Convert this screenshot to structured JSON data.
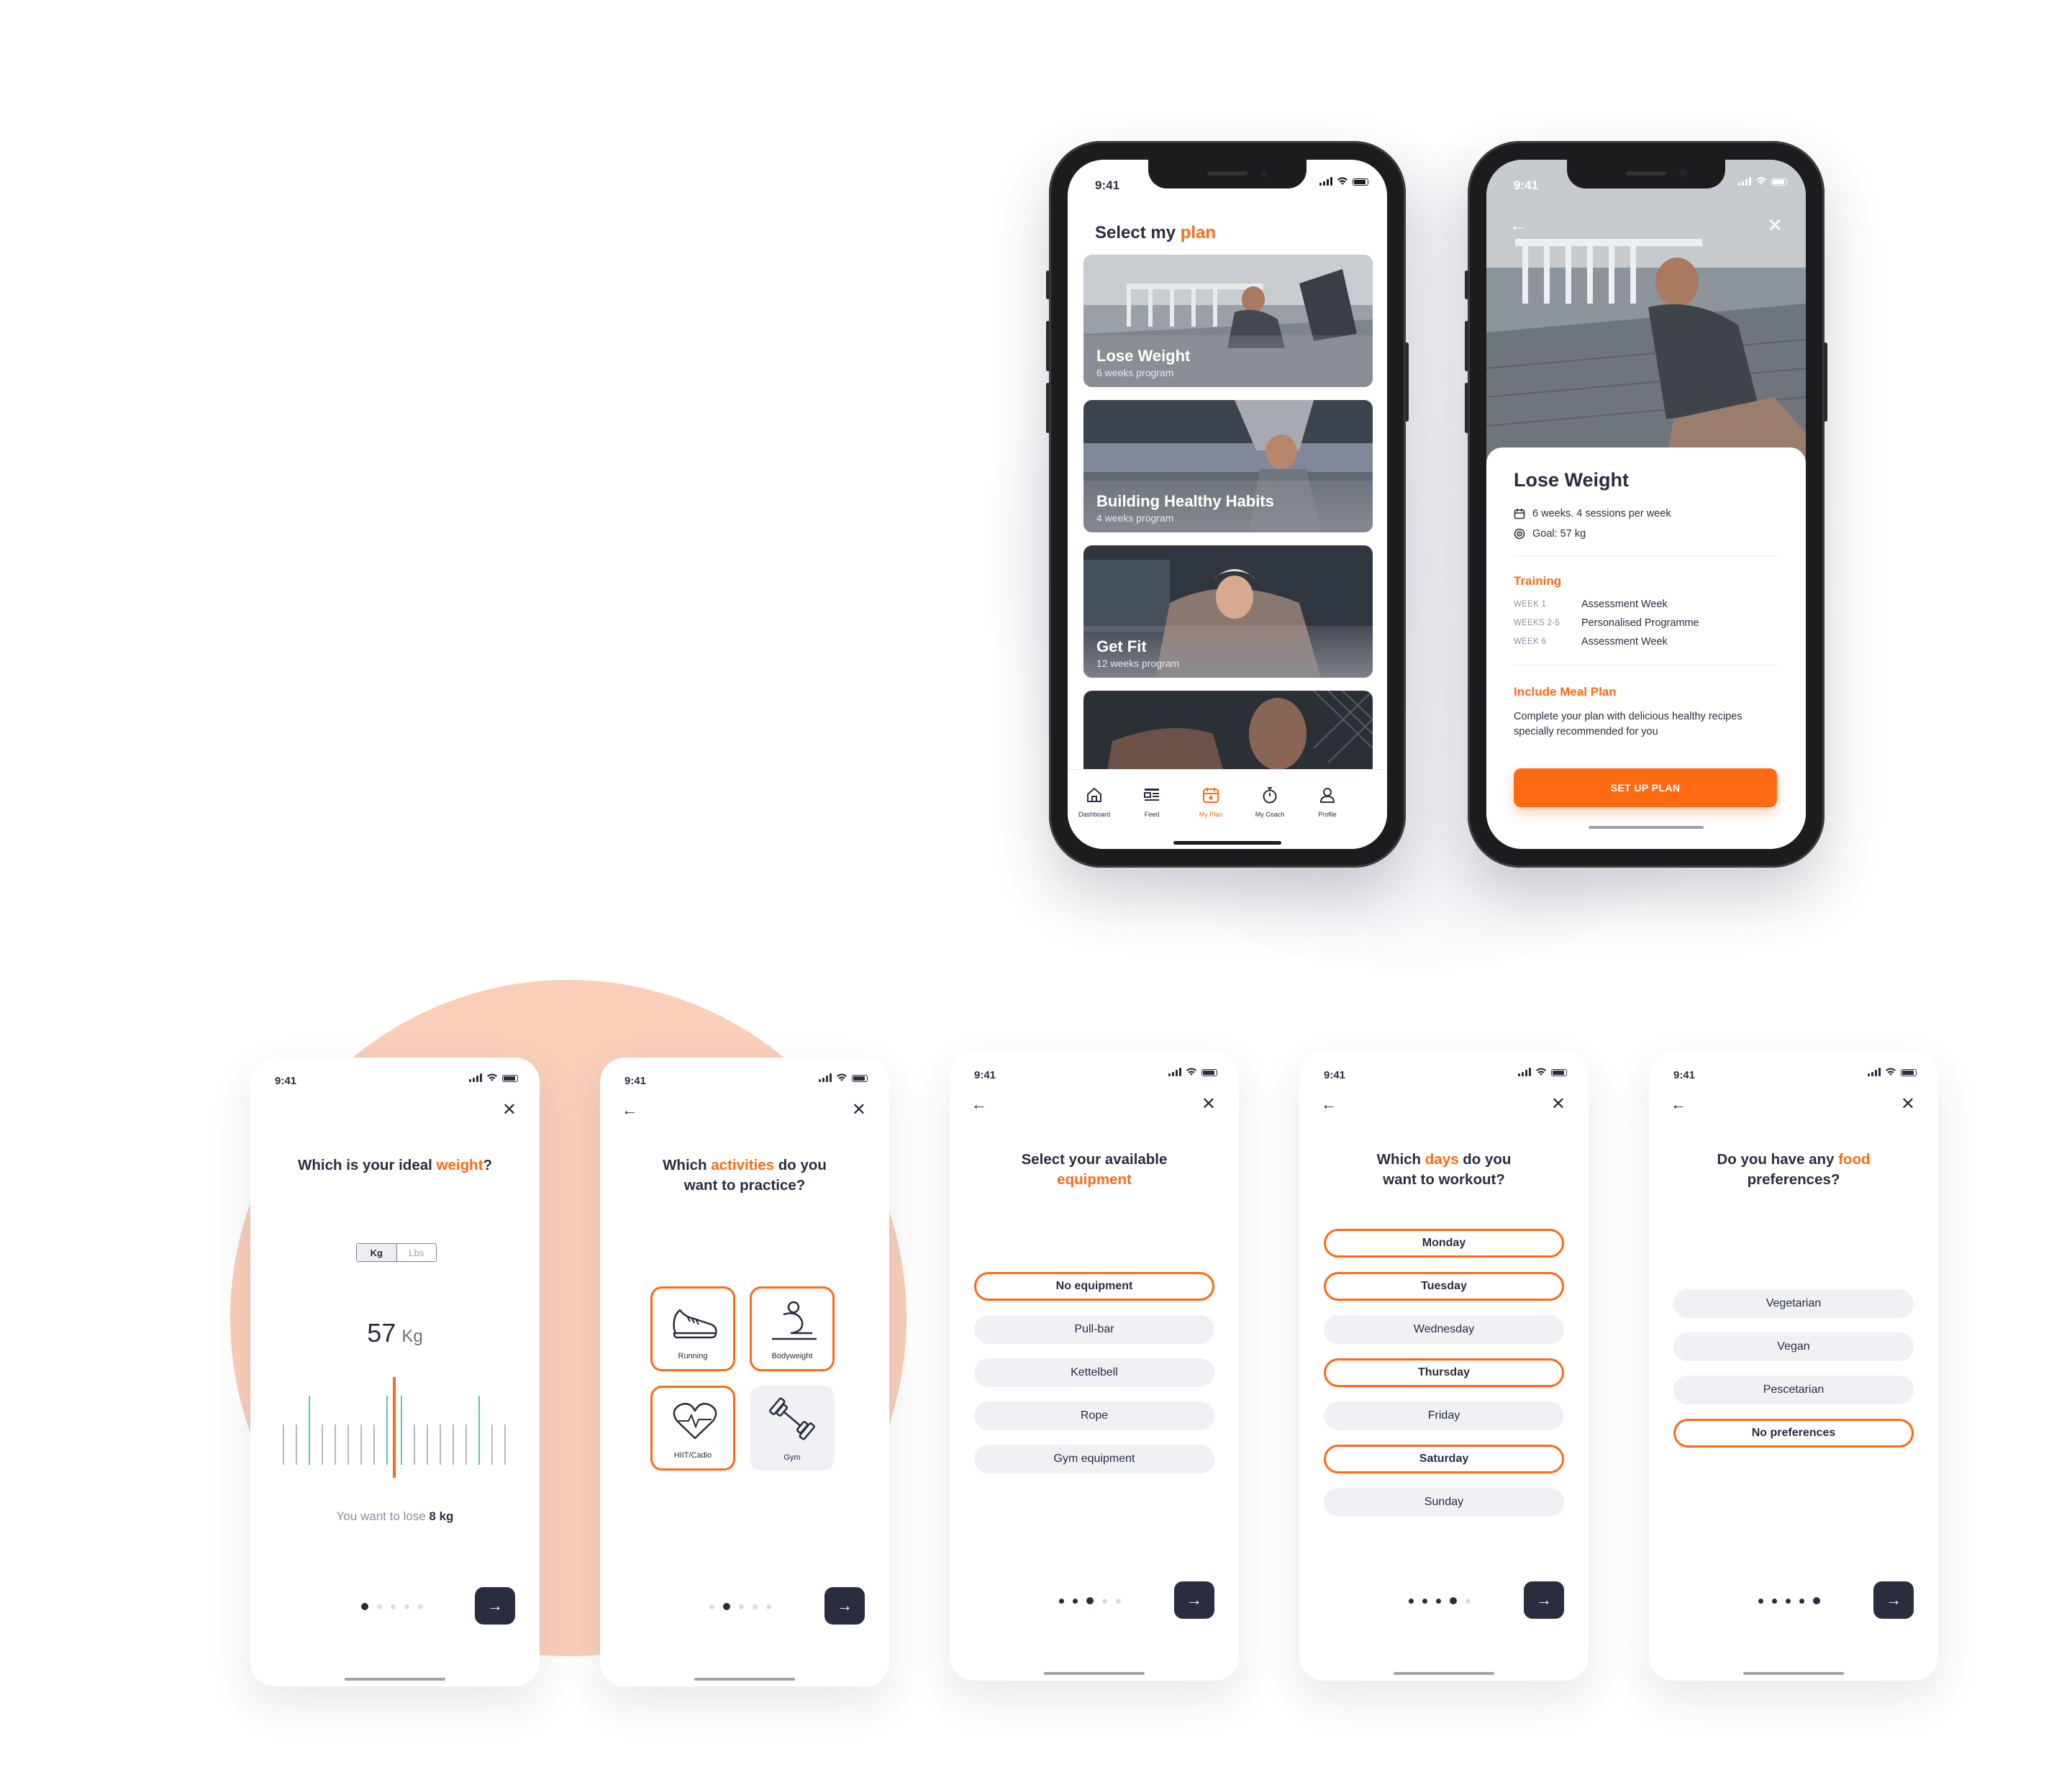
{
  "status_time": "9:41",
  "plan_list": {
    "title_prefix": "Select my ",
    "title_accent": "plan",
    "cards": [
      {
        "title": "Lose Weight",
        "subtitle": "6 weeks program"
      },
      {
        "title": "Building Healthy Habits",
        "subtitle": "4 weeks program"
      },
      {
        "title": "Get Fit",
        "subtitle": "12 weeks program"
      }
    ],
    "tabs": [
      {
        "label": "Dashboard",
        "icon": "home-icon"
      },
      {
        "label": "Feed",
        "icon": "feed-icon"
      },
      {
        "label": "My Plan",
        "icon": "calendar-icon"
      },
      {
        "label": "My Coach",
        "icon": "stopwatch-icon"
      },
      {
        "label": "Profile",
        "icon": "profile-icon"
      }
    ],
    "active_tab": "My Plan"
  },
  "plan_detail": {
    "title": "Lose Weight",
    "meta_schedule": "6 weeks. 4 sessions per week",
    "meta_goal": "Goal: 57 kg",
    "training_heading": "Training",
    "training": [
      {
        "week": "WEEK 1",
        "label": "Assessment Week"
      },
      {
        "week": "WEEKS 2-5",
        "label": "Personalised Programme"
      },
      {
        "week": "WEEK 6",
        "label": "Assessment Week"
      }
    ],
    "meal_heading": "Include Meal Plan",
    "meal_text": "Complete your plan with delicious healthy recipes specially recommended for you",
    "cta": "SET UP PLAN"
  },
  "onboarding": {
    "weight": {
      "q_prefix": "Which is your ideal ",
      "q_accent": "weight",
      "q_suffix": "?",
      "unit_on": "Kg",
      "unit_off": "Lbs",
      "value": "57",
      "unit": "Kg",
      "lose_prefix": "You want to lose ",
      "lose_amount": "8 kg"
    },
    "activities": {
      "q_prefix": "Which ",
      "q_accent": "activities",
      "q_suffix": " do you",
      "q_line2": "want to practice?",
      "items": [
        {
          "label": "Running",
          "icon": "shoe-icon",
          "selected": true
        },
        {
          "label": "Bodyweight",
          "icon": "stretch-icon",
          "selected": true
        },
        {
          "label": "HIIT/Cadio",
          "icon": "heart-pulse-icon",
          "selected": true
        },
        {
          "label": "Gym",
          "icon": "dumbbell-icon",
          "selected": false
        }
      ]
    },
    "equipment": {
      "q_line1": "Select your available",
      "q_accent": "equipment",
      "options": [
        {
          "label": "No equipment",
          "selected": true
        },
        {
          "label": "Pull-bar",
          "selected": false
        },
        {
          "label": "Kettelbell",
          "selected": false
        },
        {
          "label": "Rope",
          "selected": false
        },
        {
          "label": "Gym equipment",
          "selected": false
        }
      ]
    },
    "days": {
      "q_prefix": "Which ",
      "q_accent": "days",
      "q_suffix": " do you",
      "q_line2": "want to workout?",
      "options": [
        {
          "label": "Monday",
          "selected": true
        },
        {
          "label": "Tuesday",
          "selected": true
        },
        {
          "label": "Wednesday",
          "selected": false
        },
        {
          "label": "Thursday",
          "selected": true
        },
        {
          "label": "Friday",
          "selected": false
        },
        {
          "label": "Saturday",
          "selected": true
        },
        {
          "label": "Sunday",
          "selected": false
        }
      ]
    },
    "food": {
      "q_prefix": "Do you have any ",
      "q_accent": "food",
      "q_line2": "preferences?",
      "options": [
        {
          "label": "Vegetarian",
          "selected": false
        },
        {
          "label": "Vegan",
          "selected": false
        },
        {
          "label": "Pescetarian",
          "selected": false
        },
        {
          "label": "No preferences",
          "selected": true
        }
      ]
    }
  },
  "colors": {
    "accent": "#ff6a13",
    "dark": "#2a2d3e",
    "pill": "#f0f1f4",
    "peach": "#f9cfb9"
  }
}
